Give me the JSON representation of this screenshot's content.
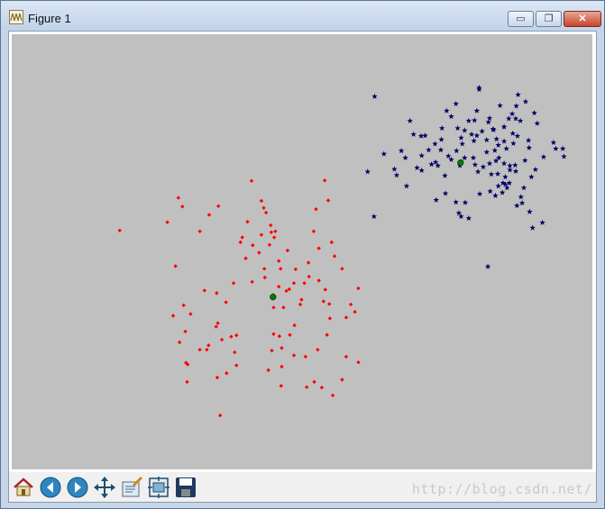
{
  "window": {
    "title": "Figure 1",
    "controls": {
      "minimize": "▭",
      "maximize": "❐",
      "close": "✕"
    }
  },
  "toolbar": {
    "buttons": [
      {
        "name": "home-button",
        "icon": "home-icon"
      },
      {
        "name": "back-button",
        "icon": "back-arrow-icon"
      },
      {
        "name": "forward-button",
        "icon": "forward-arrow-icon"
      },
      {
        "name": "pan-button",
        "icon": "pan-arrows-icon"
      },
      {
        "name": "zoom-button",
        "icon": "zoom-rect-icon"
      },
      {
        "name": "subplots-button",
        "icon": "subplots-icon"
      },
      {
        "name": "save-button",
        "icon": "floppy-disk-icon"
      }
    ],
    "watermark": "http://blog.csdn.net/"
  },
  "colors": {
    "plot_background": "#c0c0c0",
    "cluster_1": "#ff0000",
    "cluster_2": "#000066",
    "centroid": "#008000"
  },
  "chart_data": {
    "type": "scatter",
    "title": "",
    "xlabel": "",
    "ylabel": "",
    "xlim": [
      0,
      10
    ],
    "ylim": [
      0,
      10
    ],
    "grid": false,
    "series": [
      {
        "marker": "diamond",
        "color": "#ff0000",
        "points": [
          [
            1.86,
            5.49
          ],
          [
            2.87,
            6.24
          ],
          [
            2.94,
            6.04
          ],
          [
            3.4,
            5.85
          ],
          [
            3.24,
            5.47
          ],
          [
            3.56,
            6.05
          ],
          [
            3.32,
            4.11
          ],
          [
            3.08,
            3.57
          ],
          [
            3.03,
            2.41
          ],
          [
            3.02,
            2.01
          ],
          [
            3.24,
            2.75
          ],
          [
            3.62,
            2.98
          ],
          [
            3.78,
            3.05
          ],
          [
            3.55,
            3.36
          ],
          [
            3.87,
            3.08
          ],
          [
            3.87,
            2.39
          ],
          [
            3.54,
            2.11
          ],
          [
            3.7,
            2.21
          ],
          [
            3.84,
            2.69
          ],
          [
            3.69,
            3.84
          ],
          [
            3.82,
            4.28
          ],
          [
            4.03,
            4.85
          ],
          [
            3.97,
            5.33
          ],
          [
            3.94,
            5.22
          ],
          [
            4.06,
            5.69
          ],
          [
            4.15,
            5.15
          ],
          [
            4.14,
            4.31
          ],
          [
            4.35,
            4.61
          ],
          [
            4.26,
            4.98
          ],
          [
            4.3,
            5.39
          ],
          [
            4.38,
            5.9
          ],
          [
            4.46,
            5.61
          ],
          [
            4.3,
            6.17
          ],
          [
            4.13,
            6.63
          ],
          [
            4.34,
            6.01
          ],
          [
            4.44,
            5.16
          ],
          [
            4.47,
            5.45
          ],
          [
            4.54,
            5.47
          ],
          [
            4.52,
            5.33
          ],
          [
            4.75,
            5.03
          ],
          [
            4.6,
            4.79
          ],
          [
            4.63,
            4.61
          ],
          [
            4.36,
            4.41
          ],
          [
            4.5,
            4.01
          ],
          [
            4.49,
            3.96
          ],
          [
            4.51,
            3.72
          ],
          [
            4.68,
            3.72
          ],
          [
            4.51,
            3.11
          ],
          [
            4.61,
            3.06
          ],
          [
            4.48,
            2.73
          ],
          [
            4.65,
            2.79
          ],
          [
            4.65,
            2.36
          ],
          [
            4.42,
            2.28
          ],
          [
            4.64,
            1.92
          ],
          [
            4.86,
            2.62
          ],
          [
            4.79,
            3.09
          ],
          [
            4.87,
            3.31
          ],
          [
            4.97,
            3.79
          ],
          [
            4.99,
            3.9
          ],
          [
            4.73,
            4.1
          ],
          [
            4.6,
            4.2
          ],
          [
            4.78,
            4.14
          ],
          [
            4.86,
            4.28
          ],
          [
            5.04,
            4.28
          ],
          [
            4.89,
            4.6
          ],
          [
            5.11,
            4.75
          ],
          [
            5.12,
            4.43
          ],
          [
            5.2,
            5.47
          ],
          [
            5.29,
            5.08
          ],
          [
            5.24,
            5.98
          ],
          [
            5.45,
            6.18
          ],
          [
            5.51,
            5.22
          ],
          [
            5.56,
            4.9
          ],
          [
            5.29,
            4.34
          ],
          [
            5.4,
            4.13
          ],
          [
            5.37,
            3.86
          ],
          [
            5.47,
            3.8
          ],
          [
            5.48,
            3.47
          ],
          [
            5.43,
            3.09
          ],
          [
            5.27,
            2.75
          ],
          [
            5.34,
            1.88
          ],
          [
            5.21,
            2.01
          ],
          [
            5.08,
            1.89
          ],
          [
            5.06,
            2.59
          ],
          [
            5.69,
            4.61
          ],
          [
            5.84,
            3.79
          ],
          [
            5.76,
            3.49
          ],
          [
            5.91,
            3.62
          ],
          [
            5.97,
            4.16
          ],
          [
            5.39,
            6.64
          ],
          [
            5.76,
            2.59
          ],
          [
            5.97,
            2.46
          ],
          [
            5.53,
            1.7
          ],
          [
            5.69,
            2.06
          ],
          [
            3.59,
            1.24
          ],
          [
            3.52,
            3.28
          ],
          [
            2.96,
            3.77
          ],
          [
            2.78,
            3.53
          ],
          [
            2.99,
            3.17
          ],
          [
            2.89,
            2.92
          ],
          [
            2.82,
            4.67
          ],
          [
            2.68,
            5.68
          ],
          [
            3.53,
            4.05
          ],
          [
            3.39,
            2.85
          ],
          [
            3.36,
            2.75
          ],
          [
            3.0,
            2.45
          ]
        ]
      },
      {
        "marker": "star",
        "color": "#000066",
        "points": [
          [
            6.25,
            8.57
          ],
          [
            6.86,
            8.01
          ],
          [
            7.12,
            7.67
          ],
          [
            7.29,
            7.48
          ],
          [
            7.4,
            7.58
          ],
          [
            7.41,
            7.84
          ],
          [
            7.49,
            8.24
          ],
          [
            7.57,
            8.11
          ],
          [
            7.68,
            7.84
          ],
          [
            7.74,
            7.62
          ],
          [
            7.39,
            7.34
          ],
          [
            7.52,
            7.2
          ],
          [
            7.66,
            7.32
          ],
          [
            7.8,
            7.16
          ],
          [
            7.72,
            6.98
          ],
          [
            7.96,
            7.55
          ],
          [
            7.95,
            7.16
          ],
          [
            7.98,
            7.0
          ],
          [
            8.03,
            6.84
          ],
          [
            8.12,
            6.95
          ],
          [
            8.18,
            7.29
          ],
          [
            8.01,
            8.24
          ],
          [
            7.87,
            8.01
          ],
          [
            7.97,
            8.02
          ],
          [
            8.1,
            7.77
          ],
          [
            8.23,
            8.07
          ],
          [
            8.29,
            7.82
          ],
          [
            8.35,
            7.59
          ],
          [
            8.48,
            7.54
          ],
          [
            8.52,
            7.37
          ],
          [
            8.64,
            7.49
          ],
          [
            8.39,
            7.16
          ],
          [
            8.48,
            7.03
          ],
          [
            8.37,
            6.79
          ],
          [
            8.5,
            6.55
          ],
          [
            8.38,
            6.51
          ],
          [
            8.24,
            6.39
          ],
          [
            8.06,
            6.33
          ],
          [
            7.81,
            6.13
          ],
          [
            7.7,
            5.89
          ],
          [
            7.87,
            5.77
          ],
          [
            8.26,
            6.78
          ],
          [
            8.58,
            6.88
          ],
          [
            8.23,
            7.03
          ],
          [
            8.48,
            7.87
          ],
          [
            8.62,
            8.17
          ],
          [
            8.85,
            8.45
          ],
          [
            8.69,
            8.35
          ],
          [
            8.76,
            8.01
          ],
          [
            8.56,
            8.06
          ],
          [
            8.48,
            7.87
          ],
          [
            8.71,
            7.66
          ],
          [
            8.9,
            7.56
          ],
          [
            8.91,
            7.39
          ],
          [
            8.84,
            7.1
          ],
          [
            8.67,
            6.99
          ],
          [
            8.58,
            6.98
          ],
          [
            8.5,
            6.72
          ],
          [
            8.53,
            6.47
          ],
          [
            8.45,
            6.36
          ],
          [
            8.33,
            6.29
          ],
          [
            8.7,
            6.06
          ],
          [
            8.92,
            5.92
          ],
          [
            8.79,
            6.12
          ],
          [
            8.77,
            6.26
          ],
          [
            8.82,
            6.47
          ],
          [
            8.95,
            6.72
          ],
          [
            9.02,
            6.89
          ],
          [
            9.16,
            7.18
          ],
          [
            9.33,
            7.51
          ],
          [
            9.37,
            7.37
          ],
          [
            9.49,
            7.37
          ],
          [
            9.51,
            7.19
          ],
          [
            9.05,
            7.95
          ],
          [
            9.0,
            8.19
          ],
          [
            8.68,
            8.06
          ],
          [
            7.76,
            7.48
          ],
          [
            7.57,
            7.12
          ],
          [
            7.3,
            7.06
          ],
          [
            7.06,
            7.21
          ],
          [
            7.34,
            6.98
          ],
          [
            7.46,
            6.75
          ],
          [
            7.47,
            6.34
          ],
          [
            7.65,
            6.14
          ],
          [
            7.74,
            5.81
          ],
          [
            7.31,
            6.19
          ],
          [
            7.92,
            7.7
          ],
          [
            8.38,
            7.45
          ],
          [
            8.01,
            7.67
          ],
          [
            8.18,
            7.57
          ],
          [
            8.21,
            7.98
          ],
          [
            8.3,
            7.8
          ],
          [
            8.57,
            6.58
          ],
          [
            8.63,
            7.72
          ],
          [
            8.34,
            7.09
          ],
          [
            6.13,
            6.84
          ],
          [
            6.41,
            7.25
          ],
          [
            6.63,
            6.76
          ],
          [
            6.98,
            6.93
          ],
          [
            6.78,
            7.16
          ],
          [
            6.71,
            7.32
          ],
          [
            6.59,
            6.9
          ],
          [
            6.92,
            7.7
          ],
          [
            7.05,
            7.66
          ],
          [
            6.24,
            5.81
          ],
          [
            8.2,
            4.66
          ],
          [
            6.8,
            6.51
          ],
          [
            7.23,
            7.01
          ],
          [
            8.32,
            7.33
          ],
          [
            8.05,
            8.77
          ],
          [
            8.05,
            8.73
          ],
          [
            7.65,
            8.4
          ],
          [
            8.41,
            8.36
          ],
          [
            8.72,
            8.61
          ],
          [
            8.97,
            5.55
          ],
          [
            9.14,
            5.67
          ],
          [
            8.68,
            6.85
          ],
          [
            7.18,
            7.34
          ],
          [
            7.06,
            6.87
          ],
          [
            7.8,
            7.79
          ],
          [
            8.46,
            6.58
          ]
        ]
      },
      {
        "marker": "circle",
        "color": "#008000",
        "points": [
          [
            4.5,
            3.96
          ],
          [
            7.73,
            7.05
          ]
        ]
      }
    ]
  }
}
